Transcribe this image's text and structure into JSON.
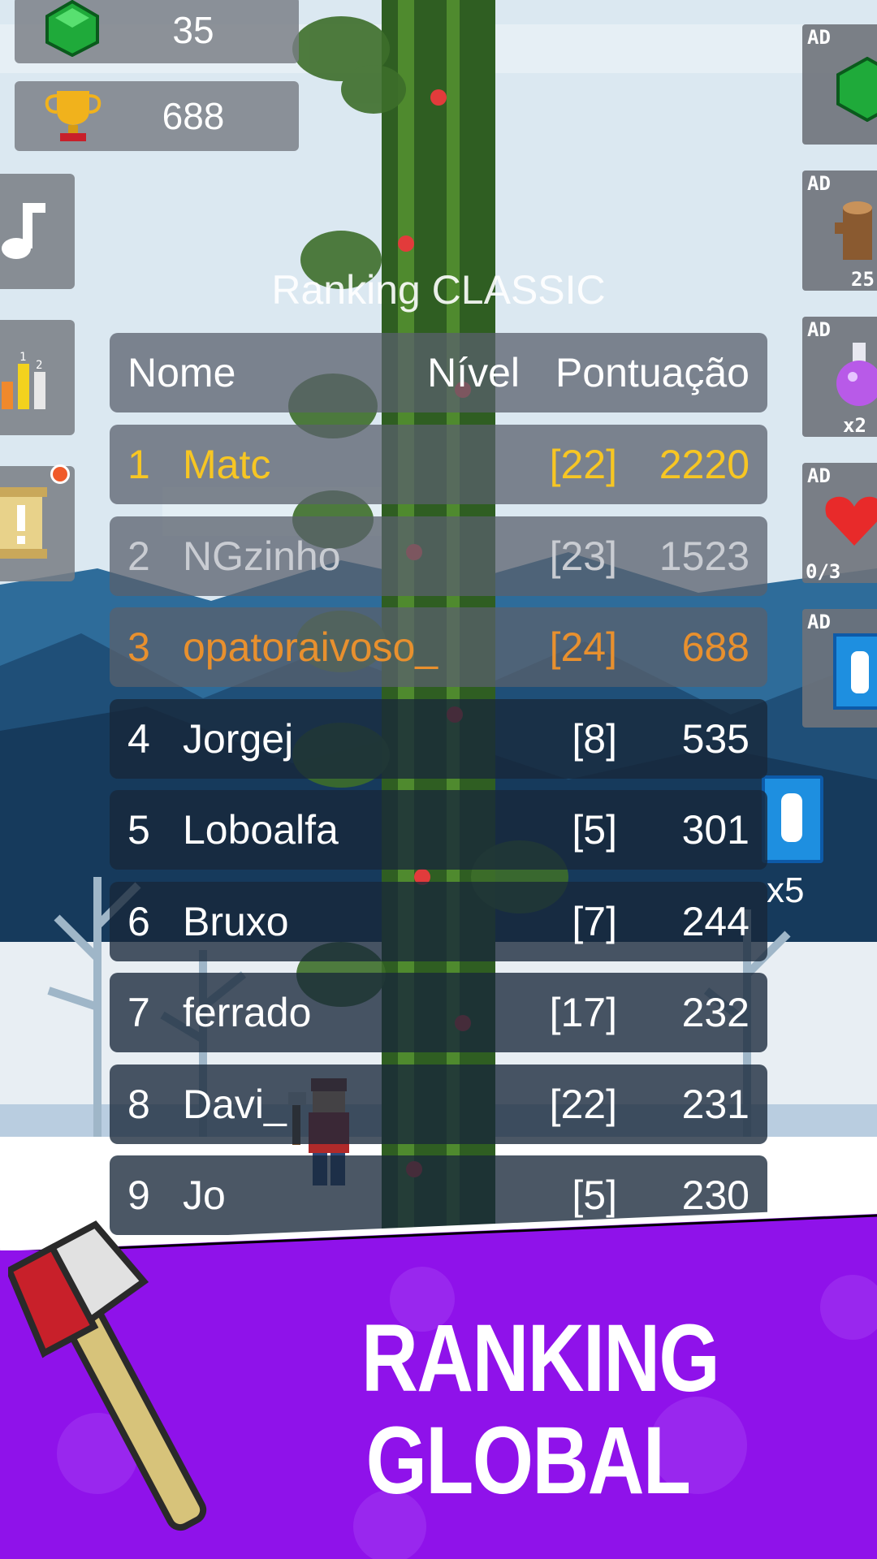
{
  "stats": {
    "gems": "35",
    "trophies": "688"
  },
  "side_buttons": [
    "music-button",
    "ranking-button",
    "notice-button"
  ],
  "ad_buttons": [
    {
      "label": "AD",
      "icon": "gem-icon",
      "sub": ""
    },
    {
      "label": "AD",
      "icon": "wood-log-icon",
      "sub": "25"
    },
    {
      "label": "AD",
      "icon": "potion-icon",
      "sub": "x2"
    },
    {
      "label": "AD",
      "icon": "heart-icon",
      "sub": "0/3"
    },
    {
      "label": "AD",
      "icon": "ticket-icon",
      "sub": ""
    }
  ],
  "ticket_multiplier": "x5",
  "ranking": {
    "title": "Ranking CLASSIC",
    "headers": {
      "name": "Nome",
      "level": "Nível",
      "score": "Pontuação"
    },
    "rows": [
      {
        "pos": "1",
        "name": "Matc",
        "level": "[22]",
        "score": "2220",
        "color": "#f7c623"
      },
      {
        "pos": "2",
        "name": "NGzinho",
        "level": "[23]",
        "score": "1523",
        "color": "#c9ccd2"
      },
      {
        "pos": "3",
        "name": "opatoraivoso_",
        "level": "[24]",
        "score": "688",
        "color": "#e8902e"
      },
      {
        "pos": "4",
        "name": "Jorgej",
        "level": "[8]",
        "score": "535",
        "color": "#ffffff"
      },
      {
        "pos": "5",
        "name": "Loboalfa",
        "level": "[5]",
        "score": "301",
        "color": "#ffffff"
      },
      {
        "pos": "6",
        "name": "Bruxo",
        "level": "[7]",
        "score": "244",
        "color": "#ffffff"
      },
      {
        "pos": "7",
        "name": "ferrado",
        "level": "[17]",
        "score": "232",
        "color": "#ffffff"
      },
      {
        "pos": "8",
        "name": "Davi_",
        "level": "[22]",
        "score": "231",
        "color": "#ffffff"
      },
      {
        "pos": "9",
        "name": "Jo",
        "level": "[5]",
        "score": "230",
        "color": "#ffffff"
      }
    ]
  },
  "banner": {
    "line1": "RANKING",
    "line2": "GLOBAL",
    "color": "#8f12ea"
  }
}
